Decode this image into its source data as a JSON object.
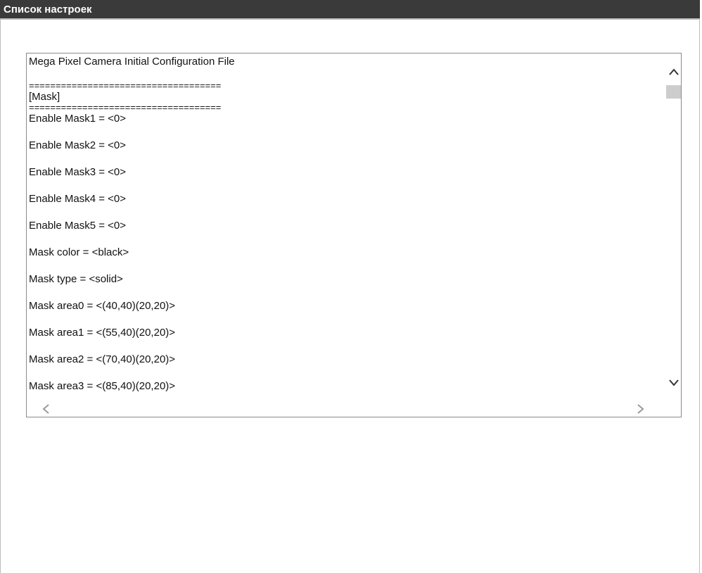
{
  "header": {
    "title": "Список настроек"
  },
  "config": {
    "lines": [
      "Mega Pixel Camera Initial Configuration File",
      "",
      "====================================",
      "[Mask]",
      "====================================",
      "Enable Mask1 = <0>",
      "",
      "Enable Mask2 = <0>",
      "",
      "Enable Mask3 = <0>",
      "",
      "Enable Mask4 = <0>",
      "",
      "Enable Mask5 = <0>",
      "",
      "Mask color = <black>",
      "",
      "Mask type = <solid>",
      "",
      "Mask area0 = <(40,40)(20,20)>",
      "",
      "Mask area1 = <(55,40)(20,20)>",
      "",
      "Mask area2 = <(70,40)(20,20)>",
      "",
      "Mask area3 = <(85,40)(20,20)>"
    ]
  },
  "scrollbar": {
    "up_icon": "chevron-up-icon",
    "down_icon": "chevron-down-icon",
    "left_icon": "chevron-left-icon",
    "right_icon": "chevron-right-icon"
  }
}
